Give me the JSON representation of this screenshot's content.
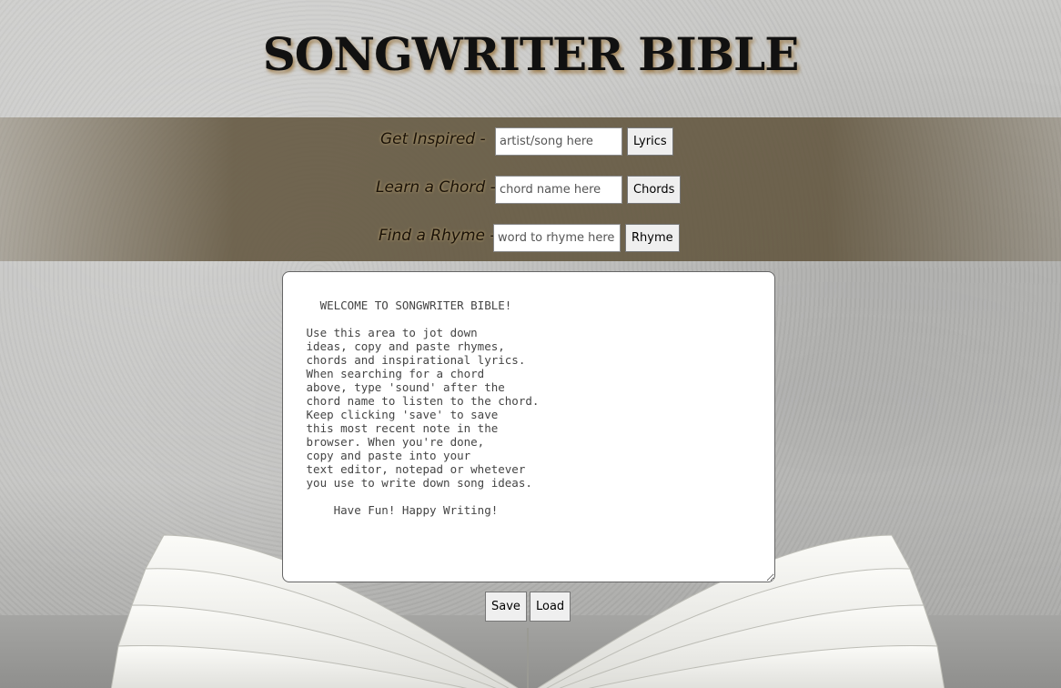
{
  "title": "SONGWRITER BIBLE",
  "tools": {
    "inspire": {
      "label": "Get Inspired -",
      "placeholder": "artist/song here",
      "button": "Lyrics"
    },
    "chord": {
      "label": "Learn a Chord -",
      "placeholder": "chord name here",
      "button": "Chords"
    },
    "rhyme": {
      "label": "Find a Rhyme -",
      "placeholder": "word to rhyme here",
      "button": "Rhyme"
    }
  },
  "notes": {
    "text": "\n   WELCOME TO SONGWRITER BIBLE!\n\n Use this area to jot down\n ideas, copy and paste rhymes,\n chords and inspirational lyrics.\n When searching for a chord\n above, type 'sound' after the\n chord name to listen to the chord.\n Keep clicking 'save' to save\n this most recent note in the\n browser. When you're done,\n copy and paste into your\n text editor, notepad or whetever\n you use to write down song ideas.\n\n     Have Fun! Happy Writing!"
  },
  "actions": {
    "save": "Save",
    "load": "Load"
  }
}
